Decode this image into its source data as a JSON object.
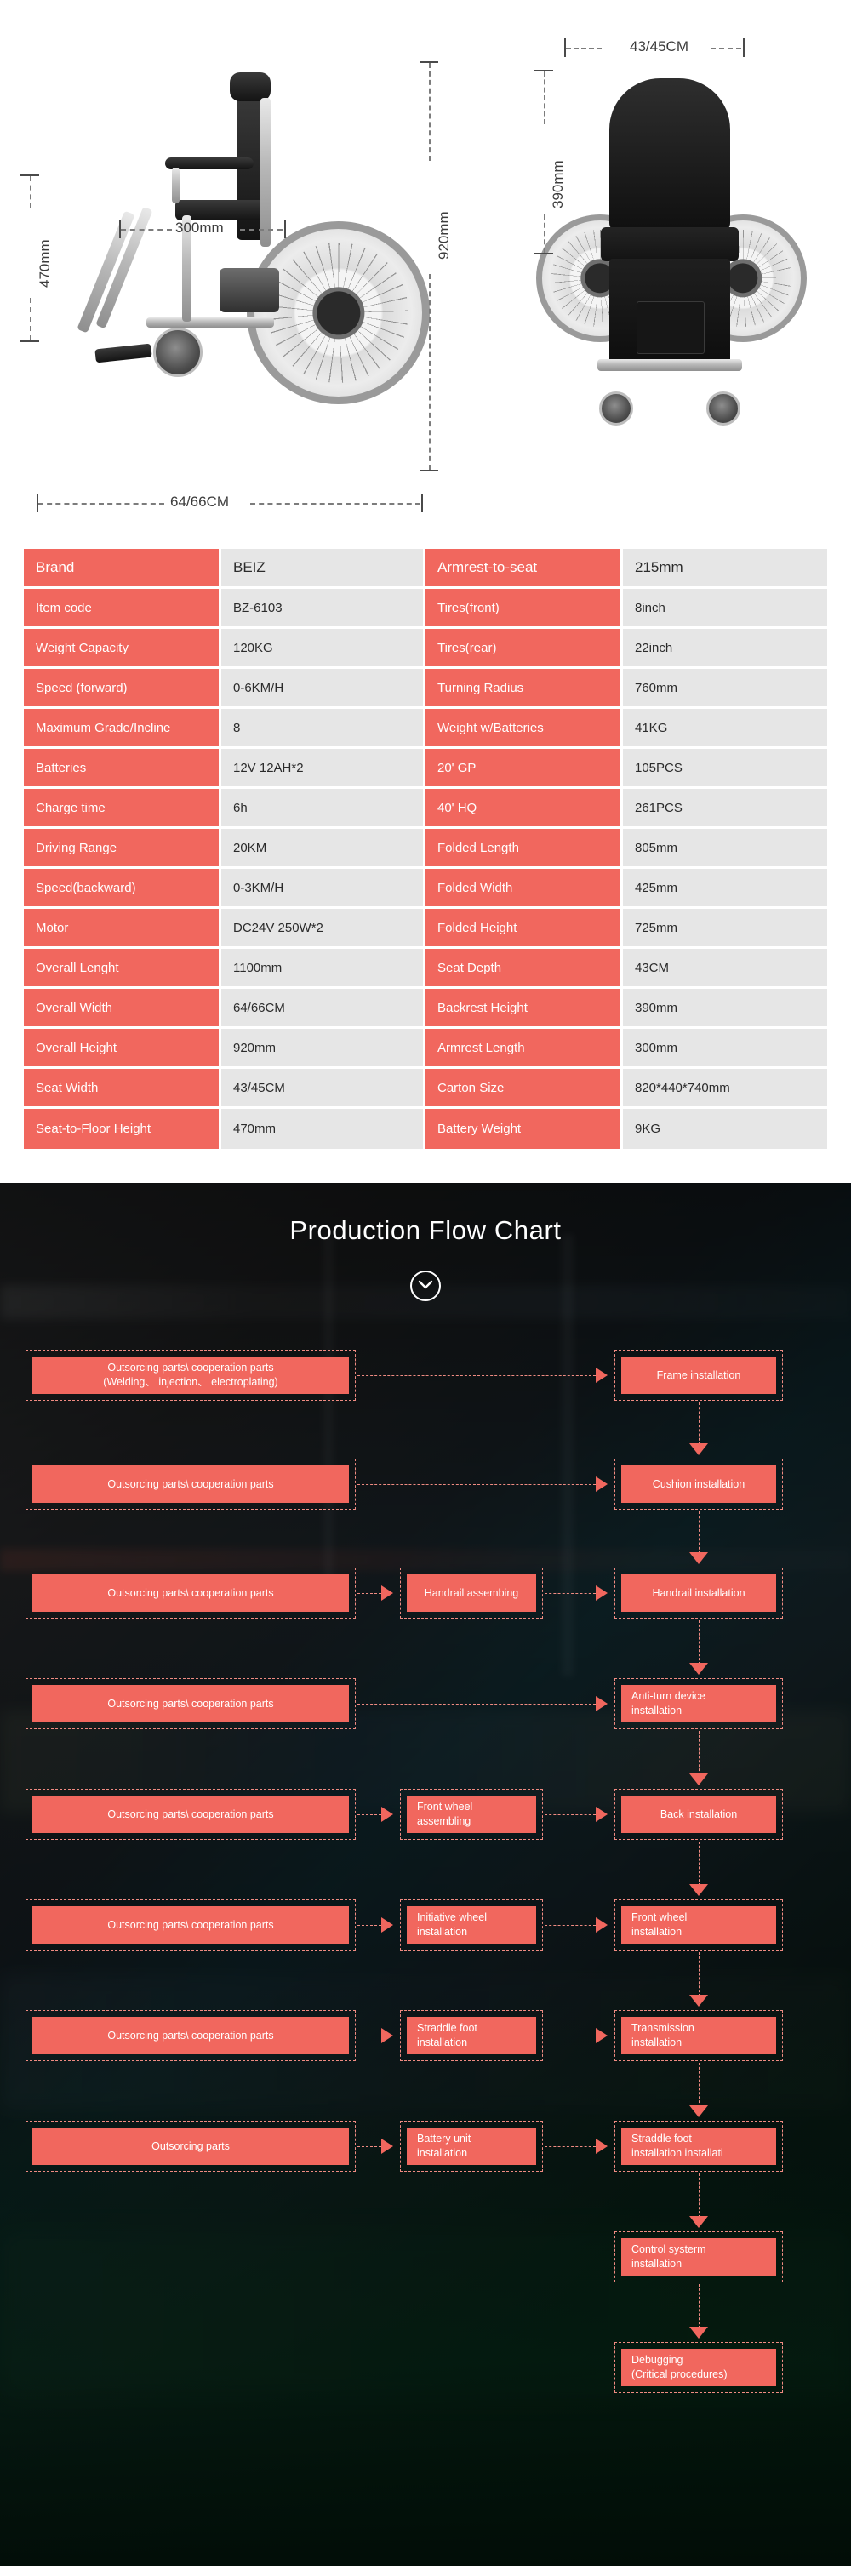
{
  "product_images": {
    "left_view": {
      "width_label": "300mm",
      "height_label": "920mm",
      "seat_height_label": "470mm",
      "overall_width_label": "64/66CM"
    },
    "right_view": {
      "seat_width_label": "43/45CM",
      "backrest_height_label": "390mm"
    }
  },
  "spec_table": {
    "rows": [
      {
        "k1": "Brand",
        "v1": "BEIZ",
        "k2": "Armrest-to-seat",
        "v2": "215mm"
      },
      {
        "k1": "Item code",
        "v1": "BZ-6103",
        "k2": "Tires(front)",
        "v2": "8inch"
      },
      {
        "k1": "Weight Capacity",
        "v1": "120KG",
        "k2": "Tires(rear)",
        "v2": "22inch"
      },
      {
        "k1": "Speed (forward)",
        "v1": "0-6KM/H",
        "k2": "Turning Radius",
        "v2": "760mm"
      },
      {
        "k1": "Maximum Grade/Incline",
        "v1": "8",
        "k2": "Weight w/Batteries",
        "v2": "41KG"
      },
      {
        "k1": "Batteries",
        "v1": "12V 12AH*2",
        "k2": "20'  GP",
        "v2": "105PCS"
      },
      {
        "k1": "Charge time",
        "v1": "6h",
        "k2": "40'  HQ",
        "v2": "261PCS"
      },
      {
        "k1": "Driving Range",
        "v1": "20KM",
        "k2": "Folded Length",
        "v2": "805mm"
      },
      {
        "k1": "Speed(backward)",
        "v1": "0-3KM/H",
        "k2": "Folded Width",
        "v2": "425mm"
      },
      {
        "k1": "Motor",
        "v1": "DC24V 250W*2",
        "k2": "Folded Height",
        "v2": "725mm"
      },
      {
        "k1": "Overall Lenght",
        "v1": "1100mm",
        "k2": "Seat Depth",
        "v2": "43CM"
      },
      {
        "k1": "Overall Width",
        "v1": "64/66CM",
        "k2": "Backrest Height",
        "v2": "390mm"
      },
      {
        "k1": "Overall Height",
        "v1": "920mm",
        "k2": "Armrest Length",
        "v2": "300mm"
      },
      {
        "k1": "Seat  Width",
        "v1": "43/45CM",
        "k2": "Carton Size",
        "v2": "820*440*740mm"
      },
      {
        "k1": "Seat-to-Floor Height",
        "v1": "470mm",
        "k2": "Battery Weight",
        "v2": "9KG"
      }
    ]
  },
  "flow": {
    "title": "Production Flow Chart",
    "scroll_icon": "chevron-down-icon",
    "boxes": {
      "l1": "Outsorcing parts\\ cooperation parts\n(Welding、 injection、 electroplating)",
      "l2": "Outsorcing parts\\ cooperation parts",
      "l3": "Outsorcing parts\\ cooperation parts",
      "l4": "Outsorcing parts\\ cooperation parts",
      "l5": "Outsorcing parts\\ cooperation parts",
      "l6": "Outsorcing parts\\ cooperation parts",
      "l7": "Outsorcing parts\\ cooperation parts",
      "l8": "Outsorcing parts",
      "m3": "Handrail assembing",
      "m6": "Front wheel\nassembling",
      "m7": "Initiative wheel\ninstallation",
      "m8": "Straddle foot\ninstallation",
      "m9": "Battery unit\ninstallation",
      "r1": "Frame installation",
      "r2": "Cushion installation",
      "r3": "Handrail installation",
      "r4": "Anti-turn device\ninstallation",
      "r5": "Back installation",
      "r6": "Front wheel\ninstallation",
      "r7": "Transmission\ninstallation",
      "r8": "Straddle foot\ninstallation installati",
      "r9": "Control systerm\ninstallation",
      "r10": "Debugging\n(Critical procedures)"
    }
  },
  "colors": {
    "accent": "#f1675e",
    "accent_border": "#f08b82",
    "table_value_bg": "#e6e6e6"
  }
}
